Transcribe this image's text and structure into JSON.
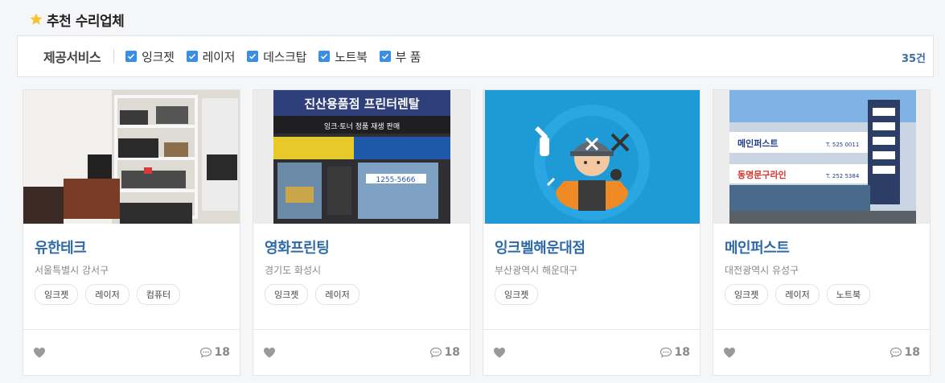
{
  "heading": {
    "title": "추천 수리업체",
    "icon": "star-icon"
  },
  "filter": {
    "label": "제공서비스",
    "options": [
      {
        "label": "잉크젯",
        "checked": true
      },
      {
        "label": "레이저",
        "checked": true
      },
      {
        "label": "데스크탑",
        "checked": true
      },
      {
        "label": "노트북",
        "checked": true
      },
      {
        "label": "부 품",
        "checked": true
      }
    ],
    "count": "35건"
  },
  "colors": {
    "accent": "#3a8ee6",
    "name": "#2f6aa8",
    "count": "#3a6ea8"
  },
  "cards": [
    {
      "name": "유한테크",
      "location": "서울특별시 강서구",
      "tags": [
        "잉크젯",
        "레이저",
        "컴퓨터"
      ],
      "comments": "18",
      "image": "workshop-shelves-photo"
    },
    {
      "name": "영화프린팅",
      "location": "경기도 화성시",
      "tags": [
        "잉크젯",
        "레이저"
      ],
      "comments": "18",
      "image": "storefront-photo"
    },
    {
      "name": "잉크벨해운대점",
      "location": "부산광역시 해운대구",
      "tags": [
        "잉크젯"
      ],
      "comments": "18",
      "image": "repairman-illustration",
      "image_text": []
    },
    {
      "name": "메인퍼스트",
      "location": "대전광역시 유성구",
      "tags": [
        "잉크젯",
        "레이저",
        "노트북"
      ],
      "comments": "18",
      "image": "building-photo"
    }
  ],
  "signs": {
    "card2_main": "진산용품점 프린터렌탈",
    "card2_sub": "잉크·토너 정품 재생 판매",
    "card2_phone": "1255-5666",
    "card4_sign1": "메인퍼스트",
    "card4_phone1": "T. 525 0011",
    "card4_sign2": "동명문구라인",
    "card4_phone2": "T. 252 5384"
  }
}
